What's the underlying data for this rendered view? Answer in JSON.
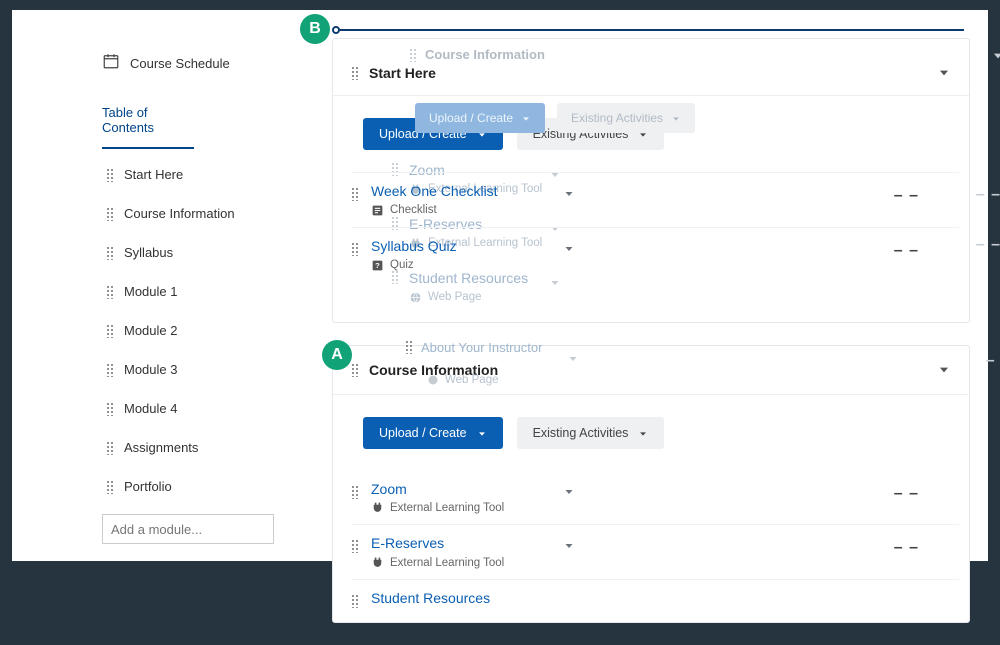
{
  "sidebar": {
    "course_schedule": "Course Schedule",
    "toc": "Table of Contents",
    "items": [
      "Start Here",
      "Course Information",
      "Syllabus",
      "Module 1",
      "Module 2",
      "Module 3",
      "Module 4",
      "Assignments",
      "Portfolio"
    ],
    "add_placeholder": "Add a module..."
  },
  "badges": {
    "a": "A",
    "b": "B"
  },
  "buttons": {
    "upload": "Upload / Create",
    "existing": "Existing Activities"
  },
  "module1": {
    "title": "Start Here",
    "ghost_title": "Course Information",
    "items": [
      {
        "title": "Week One Checklist",
        "type": "Checklist"
      },
      {
        "title": "Syllabus Quiz",
        "type": "Quiz"
      }
    ],
    "ghost_items": [
      {
        "title": "Zoom",
        "type": "External Learning Tool"
      },
      {
        "title": "E-Reserves",
        "type": "External Learning Tool"
      },
      {
        "title": "Student Resources",
        "type": "Web Page"
      }
    ],
    "dash": "– –"
  },
  "module2": {
    "title": "Course Information",
    "ghost_over": {
      "title": "About Your Instructor",
      "type": "Web Page"
    },
    "items": [
      {
        "title": "Zoom",
        "type": "External Learning Tool"
      },
      {
        "title": "E-Reserves",
        "type": "External Learning Tool"
      },
      {
        "title": "Student Resources",
        "type": ""
      }
    ],
    "dash": "– –"
  }
}
